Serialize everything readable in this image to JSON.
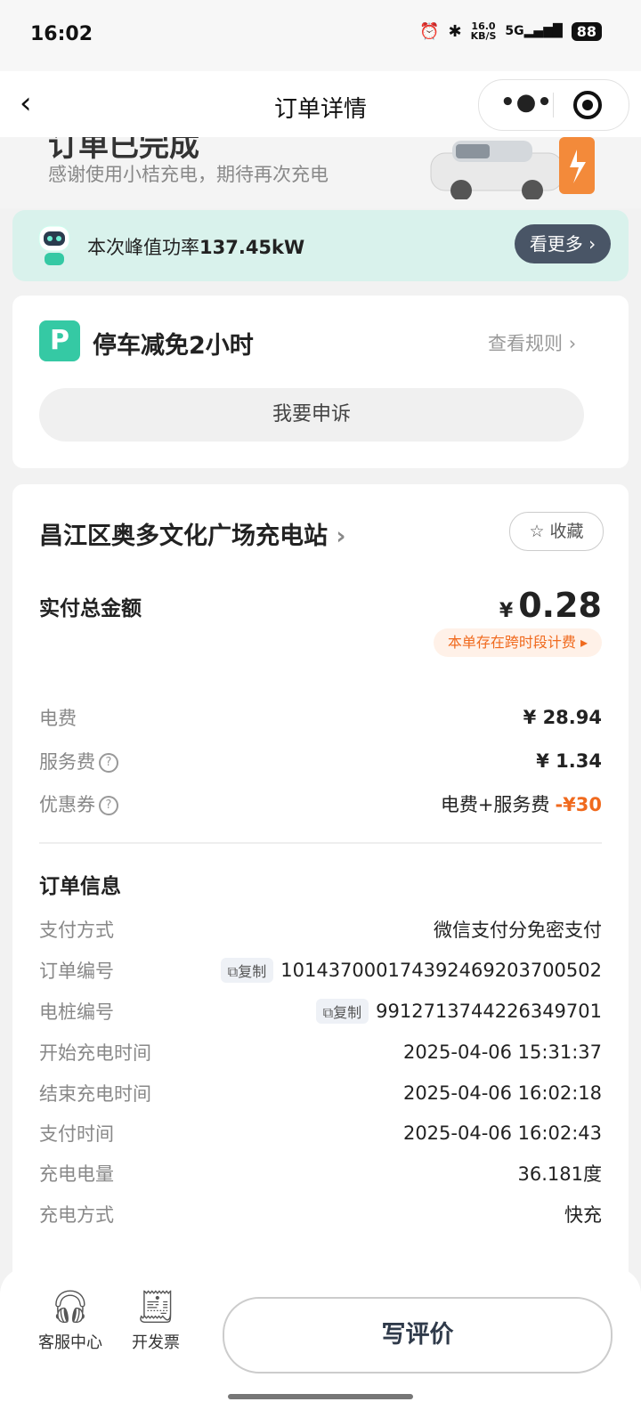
{
  "status_bar": {
    "time": "16:02",
    "net_speed": "16.0",
    "net_unit": "KB/S",
    "network": "5G",
    "battery": "88"
  },
  "nav": {
    "title": "订单详情",
    "more_icon": "more-dots-icon",
    "close_icon": "target-icon"
  },
  "banner": {
    "title": "订单已完成",
    "subtitle": "感谢使用小桔充电，期待再次充电"
  },
  "peak": {
    "prefix": "本次峰值功率",
    "value": "137.45kW",
    "button": "看更多"
  },
  "parking": {
    "icon_letter": "P",
    "title": "停车减免2小时",
    "rule_link": "查看规则",
    "appeal_button": "我要申诉"
  },
  "station": {
    "name": "昌江区奥多文化广场充电站",
    "favorite": "收藏"
  },
  "payment": {
    "total_label": "实付总金额",
    "currency": "¥",
    "total": "0.28",
    "cross_tag": "本单存在跨时段计费",
    "fees": [
      {
        "label": "电费",
        "value": "¥ 28.94",
        "help": false
      },
      {
        "label": "服务费",
        "value": "¥ 1.34",
        "help": true
      },
      {
        "label": "优惠券",
        "note": "电费+服务费",
        "value": "-¥30",
        "help": true
      }
    ]
  },
  "order_info": {
    "title": "订单信息",
    "copy_label": "复制",
    "rows": [
      {
        "label": "支付方式",
        "value": "微信支付分免密支付"
      },
      {
        "label": "订单编号",
        "value": "1014370001743924692037005​02",
        "copy": true
      },
      {
        "label": "电桩编号",
        "value": "9912713744226349701",
        "copy": true
      },
      {
        "label": "开始充电时间",
        "value": "2025-04-06 15:31:37"
      },
      {
        "label": "结束充电时间",
        "value": "2025-04-06 16:02:18"
      },
      {
        "label": "支付时间",
        "value": "2025-04-06 16:02:43"
      },
      {
        "label": "充电电量",
        "value": "36.181度"
      },
      {
        "label": "充电方式",
        "value": "快充"
      }
    ]
  },
  "bottom": {
    "service_label": "客服中心",
    "invoice_label": "开发票",
    "review_button": "写评价"
  },
  "colors": {
    "accent_orange": "#f06a1e",
    "mint": "#35c9a4",
    "peak_bg": "#d9f2ec",
    "dark_button": "#495566"
  }
}
